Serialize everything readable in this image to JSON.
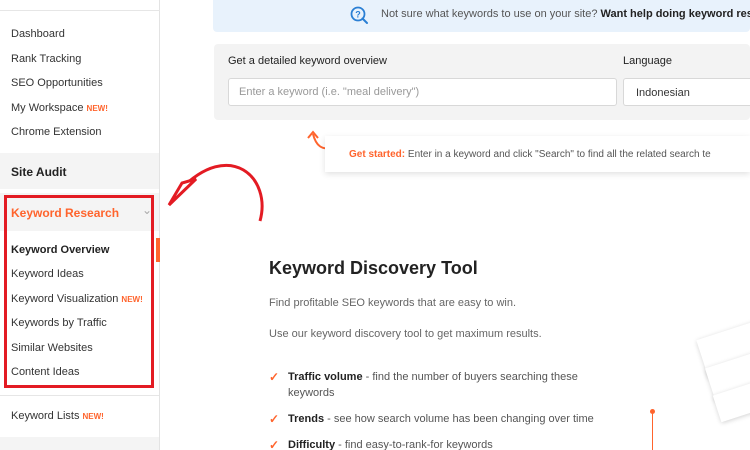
{
  "sidebar": {
    "items": [
      {
        "label": "Dashboard"
      },
      {
        "label": "Rank Tracking"
      },
      {
        "label": "SEO Opportunities"
      },
      {
        "label": "My Workspace",
        "badge": "NEW!"
      },
      {
        "label": "Chrome Extension"
      }
    ],
    "site_audit": "Site Audit",
    "keyword_research": {
      "label": "Keyword Research",
      "items": [
        {
          "label": "Keyword Overview",
          "active": true
        },
        {
          "label": "Keyword Ideas"
        },
        {
          "label": "Keyword Visualization",
          "badge": "NEW!"
        },
        {
          "label": "Keywords by Traffic"
        },
        {
          "label": "Similar Websites"
        },
        {
          "label": "Content Ideas"
        }
      ]
    },
    "keyword_lists": {
      "label": "Keyword Lists",
      "badge": "NEW!"
    }
  },
  "banner": {
    "text": "Not sure what keywords to use on your site?",
    "link": "Want help doing keyword research"
  },
  "search": {
    "label": "Get a detailed keyword overview",
    "placeholder": "Enter a keyword (i.e. \"meal delivery\")",
    "language_label": "Language",
    "language_value": "Indonesian"
  },
  "hint": {
    "bold": "Get started:",
    "text": "Enter in a keyword and click \"Search\" to find all the related search te"
  },
  "tool": {
    "title": "Keyword Discovery Tool",
    "desc1": "Find profitable SEO keywords that are easy to win.",
    "desc2": "Use our keyword discovery tool to get maximum results.",
    "features": [
      {
        "bold": "Traffic volume",
        "text": " - find the number of buyers searching these keywords"
      },
      {
        "bold": "Trends",
        "text": " - see how search volume has been changing over time"
      },
      {
        "bold": "Difficulty",
        "text": " - find easy-to-rank-for keywords"
      }
    ]
  },
  "colors": {
    "accent": "#ff642d",
    "highlight": "#e31b23",
    "banner_bg": "#e8f2fc"
  },
  "icons": {
    "help": "question-search-icon",
    "check": "check-icon",
    "hint": "curved-arrow-icon"
  }
}
